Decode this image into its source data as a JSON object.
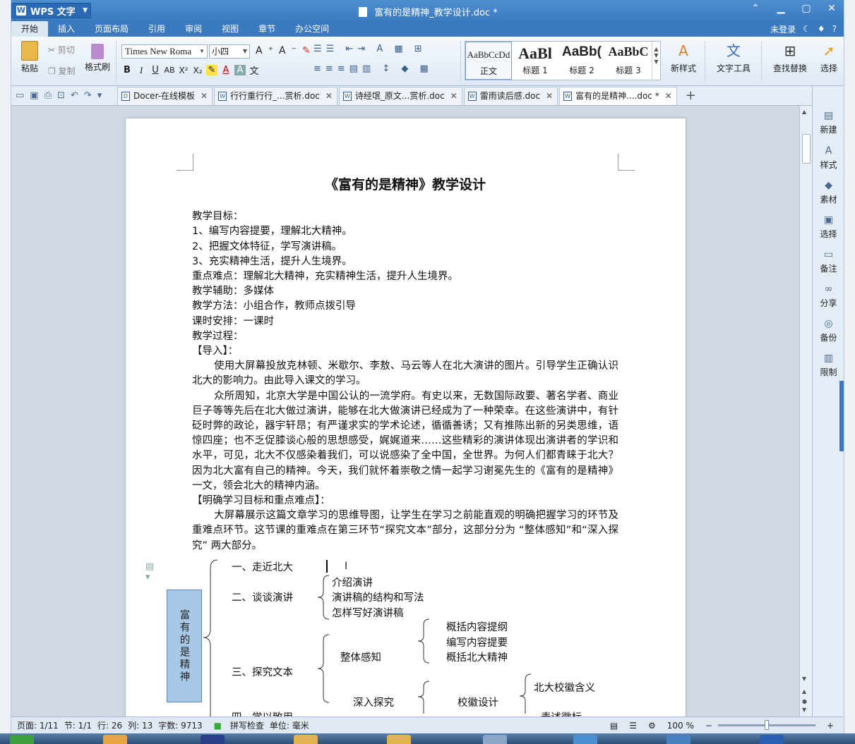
{
  "window": {
    "app_name": "WPS 文字",
    "doc_title": "富有的是精神_教学设计.doc *",
    "controls": [
      "⌃",
      "▁",
      "▢",
      "✕"
    ]
  },
  "menu": {
    "tabs": [
      "开始",
      "插入",
      "页面布局",
      "引用",
      "审阅",
      "视图",
      "章节",
      "办公空间"
    ],
    "active_tab": "开始",
    "login": "未登录"
  },
  "ribbon": {
    "paste": "粘贴",
    "cut": "剪切",
    "copy": "复制",
    "format_painter": "格式刷",
    "font_name": "Times New Roma",
    "font_size": "小四",
    "styles": [
      {
        "preview": "AaBbCcDd",
        "name": "正文"
      },
      {
        "preview": "AaBl",
        "name": "标题 1"
      },
      {
        "preview": "AaBb(",
        "name": "标题 2"
      },
      {
        "preview": "AaBbC",
        "name": "标题 3"
      }
    ],
    "new_style": "新样式",
    "text_tools": "文字工具",
    "find_replace": "查找替换",
    "select": "选择"
  },
  "doc_tabs": [
    {
      "label": "Docer-在线模板",
      "active": false
    },
    {
      "label": "行行重行行_...赏析.doc",
      "active": false
    },
    {
      "label": "诗经氓_原文...赏析.doc",
      "active": false
    },
    {
      "label": "雷雨读后感.doc",
      "active": false
    },
    {
      "label": "富有的是精神....doc *",
      "active": true
    }
  ],
  "document": {
    "title": "《富有的是精神》教学设计",
    "lines": [
      "教学目标：",
      "1、编写内容提要，理解北大精神。",
      "2、把握文体特征，学写演讲稿。",
      "3、充实精神生活，提升人生境界。",
      "重点难点：理解北大精神，充实精神生活，提升人生境界。",
      "教学辅助：多媒体",
      "教学方法：小组合作，教师点拨引导",
      "课时安排：一课时",
      "教学过程：",
      "【导入】："
    ],
    "para1": "使用大屏幕投放克林顿、米歇尔、李敖、马云等人在北大演讲的图片。引导学生正确认识北大的影响力。由此导入课文的学习。",
    "para2": "众所周知，北京大学是中国公认的一流学府。有史以来，无数国际政要、著名学者、商业巨子等等先后在北大做过演讲，能够在北大做演讲已经成为了一种荣幸。在这些演讲中，有针砭时弊的政论，器宇轩昂；有严谨求实的学术论述，循循善诱；又有推陈出新的另类思维，语惊四座；也不乏促膝谈心般的思想感受，娓娓道来……这些精彩的演讲体现出演讲者的学识和水平，可见，北大不仅感染着我们，可以说感染了全中国，全世界。为何人们都青睐于北大？因为北大富有自己的精神。今天，我们就怀着崇敬之情一起学习谢冕先生的《富有的是精神》一文，领会北大的精神内涵。",
    "heading2": "【明确学习目标和重点难点】：",
    "para3": "大屏幕展示这篇文章学习的思维导图，让学生在学习之前能直观的明确把握学习的环节及重难点环节。这节课的重难点在第三环节“探究文本”部分，这部分分为 “整体感知”和“深入探究” 两大部分。"
  },
  "mindmap": {
    "root": "富有的是精神",
    "n1": "一、走近北大",
    "n2": "二、谈谈演讲",
    "n2a": "介绍演讲",
    "n2b": "演讲稿的结构和写法",
    "n2c": "怎样写好演讲稿",
    "n3": "三、探究文本",
    "n3a": "整体感知",
    "n3a1": "概括内容提纲",
    "n3a2": "编写内容提要",
    "n3a3": "概括北大精神",
    "n3b": "深入探究",
    "n3b1": "校徽设计",
    "n3b1a": "北大校徽含义",
    "n3b1b": "表述徽标",
    "n4": "四、学以致用"
  },
  "right_pane": [
    "新建",
    "样式",
    "素材",
    "选择",
    "备注",
    "分享",
    "备份",
    "限制"
  ],
  "status": {
    "page": "页面: 1/11",
    "section": "节: 1/1",
    "row": "行: 26",
    "col": "列: 13",
    "words": "字数: 9713",
    "spell": "拼写检查",
    "unit": "单位: 毫米",
    "zoom": "100 %"
  },
  "colors": {
    "titlebar": "#3b7ac0",
    "mind_root_fill": "#a8c8e8"
  }
}
